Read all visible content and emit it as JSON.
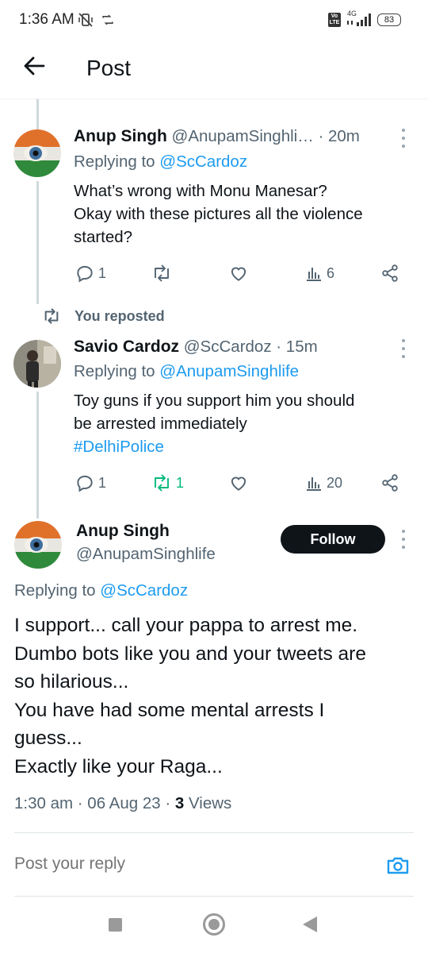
{
  "status_bar": {
    "time": "1:36 AM",
    "network": "4G",
    "battery": "83",
    "volte": "Vo LTE"
  },
  "header": {
    "title": "Post"
  },
  "tweets": [
    {
      "name": "Anup Singh",
      "handle": "@AnupamSinghli…",
      "time": "· 20m",
      "replying_prefix": "Replying to ",
      "replying_to": "@ScCardoz",
      "text_lines": [
        "What’s wrong with Monu Manesar?",
        "Okay with these pictures all the violence",
        "started?"
      ],
      "replies": "1",
      "reposts": "",
      "views": "6"
    },
    {
      "repost_label": "You reposted",
      "name": "Savio Cardoz",
      "handle": "@ScCardoz",
      "time": "· 15m",
      "replying_prefix": "Replying to ",
      "replying_to": "@AnupamSinghlife",
      "text_lines": [
        "Toy guns if you support him you should",
        "be arrested immediately"
      ],
      "hashtag": "#DelhiPolice",
      "replies": "1",
      "reposts": "1",
      "views": "20"
    }
  ],
  "main_tweet": {
    "name": "Anup Singh",
    "handle": "@AnupamSinghlife",
    "follow_label": "Follow",
    "replying_prefix": "Replying to ",
    "replying_to": "@ScCardoz",
    "text_lines": [
      "I support... call your pappa to arrest me.",
      "Dumbo bots like you and your tweets are",
      "so hilarious...",
      "You have had some mental arrests I",
      "guess...",
      "Exactly like your Raga..."
    ],
    "timestamp": "1:30 am · 06 Aug 23 · ",
    "views_count": "3",
    "views_label": " Views"
  },
  "reply_bar": {
    "placeholder": "Post your reply"
  },
  "colors": {
    "accent": "#1d9bf0",
    "repost_green": "#00ba7c",
    "text": "#0f1419",
    "muted": "#536471"
  }
}
